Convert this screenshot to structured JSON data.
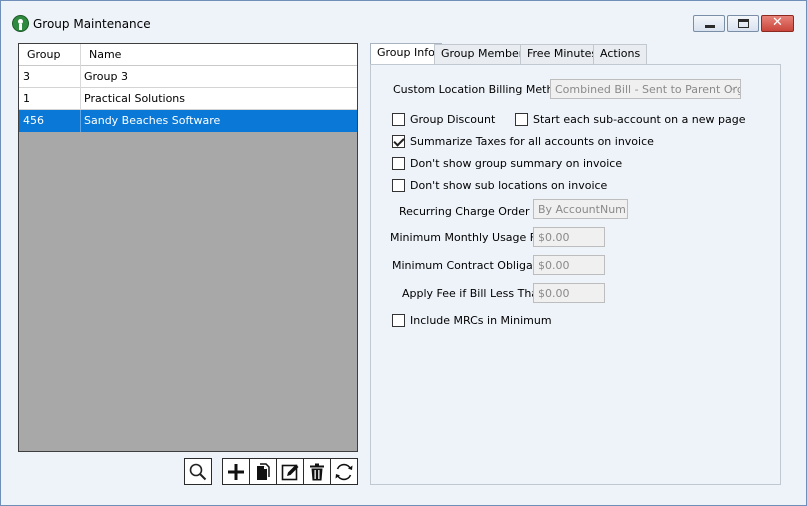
{
  "window": {
    "title": "Group Maintenance"
  },
  "grid": {
    "columns": [
      "Group",
      "Name"
    ],
    "rows": [
      {
        "group": "3",
        "name": "Group 3",
        "selected": false
      },
      {
        "group": "1",
        "name": "Practical Solutions",
        "selected": false
      },
      {
        "group": "456",
        "name": "Sandy Beaches Software",
        "selected": true
      }
    ]
  },
  "toolbar": {
    "icons": [
      "search-icon",
      "add-icon",
      "copy-icon",
      "edit-icon",
      "delete-icon",
      "refresh-icon"
    ]
  },
  "tabs": [
    {
      "label": "Group Info",
      "active": true
    },
    {
      "label": "Group Members",
      "active": false
    },
    {
      "label": "Free Minutes",
      "active": false
    },
    {
      "label": "Actions",
      "active": false
    }
  ],
  "group_info": {
    "billing_method_label": "Custom Location Billing Method",
    "billing_method_value": "Combined Bill - Sent to Parent Organ",
    "group_discount_label": "Group Discount",
    "group_discount_checked": false,
    "start_sub_account_label": "Start each sub-account on a new page",
    "start_sub_account_checked": false,
    "summarize_taxes_label": "Summarize Taxes for all accounts on invoice",
    "summarize_taxes_checked": true,
    "dont_show_summary_label": "Don't show group summary on invoice",
    "dont_show_summary_checked": false,
    "dont_show_sub_locations_label": "Don't show sub locations on invoice",
    "dont_show_sub_locations_checked": false,
    "recurring_order_label": "Recurring Charge Order By",
    "recurring_order_value": "By AccountNum",
    "min_usage_fee_label": "Minimum Monthly Usage Fee",
    "min_usage_fee_value": "$0.00",
    "min_contract_label": "Minimum Contract Obligation",
    "min_contract_value": "$0.00",
    "apply_fee_label": "Apply Fee if Bill Less Than",
    "apply_fee_value": "$0.00",
    "include_mrcs_label": "Include MRCs in Minimum",
    "include_mrcs_checked": false
  },
  "colors": {
    "selection": "#0a78d7",
    "grid_background": "#a8a8a8",
    "window_background": "#eef3fa"
  }
}
